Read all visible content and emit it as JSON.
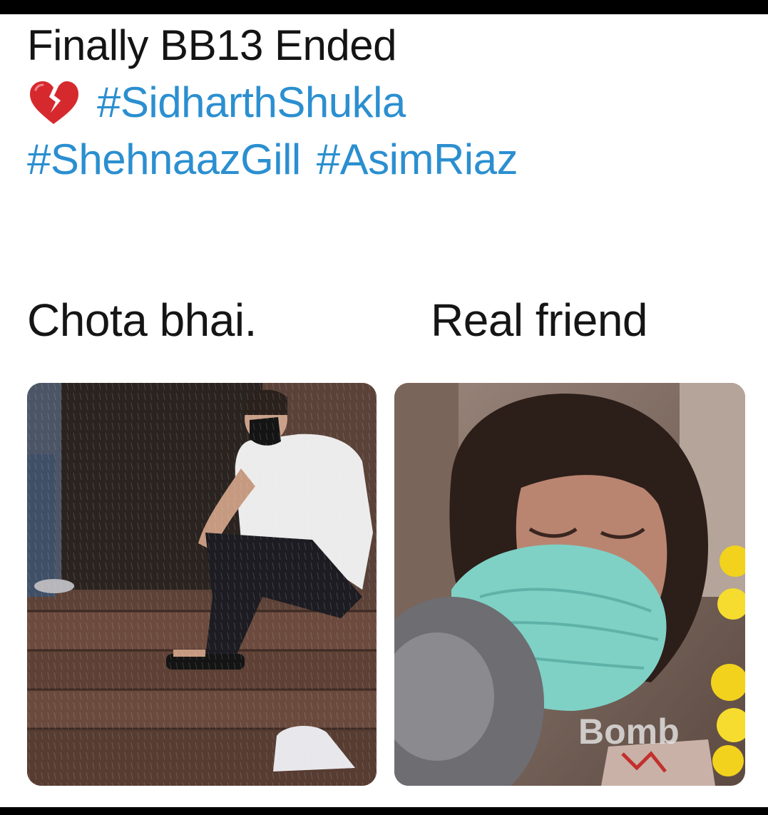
{
  "post": {
    "title": "Finally BB13 Ended",
    "emoji_icon": "broken-heart-icon",
    "hashtags_line1": [
      "#SidharthShukla"
    ],
    "hashtags_line2": [
      "#ShehnaazGill",
      "#AsimRiaz"
    ]
  },
  "captions": {
    "left": "Chota bhai.",
    "right": "Real friend"
  },
  "photos": {
    "left": {
      "description_icon": "man-sitting-on-steps-photo"
    },
    "right": {
      "description_icon": "woman-in-mask-photo",
      "watermark": "Bomb"
    }
  },
  "colors": {
    "hashtag": "#2b8fd0",
    "text": "#141414",
    "background": "#ffffff",
    "border": "#000000"
  }
}
